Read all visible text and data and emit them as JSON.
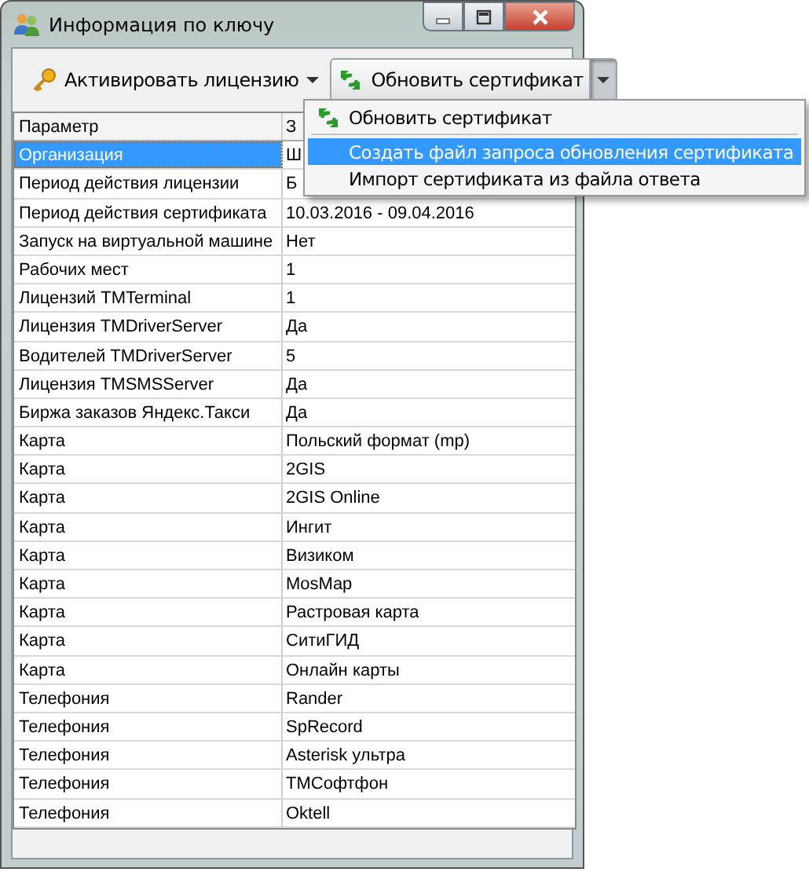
{
  "window": {
    "title": "Информация по ключу"
  },
  "toolbar": {
    "activate_button": {
      "label": "Активировать лицензию"
    },
    "update_button": {
      "label": "Обновить сертификат",
      "dropdown_open": true
    }
  },
  "menu": {
    "items": [
      {
        "label": "Обновить сертификат",
        "kind": "icon",
        "highlighted": false
      },
      {
        "kind": "separator"
      },
      {
        "label": "Создать файл запроса обновления сертификата",
        "kind": "plain",
        "highlighted": true
      },
      {
        "label": "Импорт сертификата из файла ответа",
        "kind": "plain",
        "highlighted": false
      }
    ]
  },
  "table": {
    "columns": [
      "Параметр",
      "З"
    ],
    "rows": [
      {
        "cells": [
          "Организация",
          "Ш"
        ],
        "selected": true
      },
      {
        "cells": [
          "Период действия лицензии",
          "Б"
        ],
        "selected": false
      },
      {
        "cells": [
          "Период действия сертификата",
          "10.03.2016 - 09.04.2016"
        ],
        "selected": false
      },
      {
        "cells": [
          "Запуск на виртуальной машине",
          "Нет"
        ],
        "selected": false
      },
      {
        "cells": [
          "Рабочих мест",
          "1"
        ],
        "selected": false
      },
      {
        "cells": [
          "Лицензий TMTerminal",
          "1"
        ],
        "selected": false
      },
      {
        "cells": [
          "Лицензия TMDriverServer",
          "Да"
        ],
        "selected": false
      },
      {
        "cells": [
          "Водителей TMDriverServer",
          "5"
        ],
        "selected": false
      },
      {
        "cells": [
          "Лицензия TMSMSServer",
          "Да"
        ],
        "selected": false
      },
      {
        "cells": [
          "Биржа заказов Яндекс.Такси",
          "Да"
        ],
        "selected": false
      },
      {
        "cells": [
          "Карта",
          "Польский формат (mp)"
        ],
        "selected": false
      },
      {
        "cells": [
          "Карта",
          "2GIS"
        ],
        "selected": false
      },
      {
        "cells": [
          "Карта",
          "2GIS Online"
        ],
        "selected": false
      },
      {
        "cells": [
          "Карта",
          "Ингит"
        ],
        "selected": false
      },
      {
        "cells": [
          "Карта",
          "Визиком"
        ],
        "selected": false
      },
      {
        "cells": [
          "Карта",
          "MosMap"
        ],
        "selected": false
      },
      {
        "cells": [
          "Карта",
          "Растровая карта"
        ],
        "selected": false
      },
      {
        "cells": [
          "Карта",
          "СитиГИД"
        ],
        "selected": false
      },
      {
        "cells": [
          "Карта",
          "Онлайн карты"
        ],
        "selected": false
      },
      {
        "cells": [
          "Телефония",
          "Rander"
        ],
        "selected": false
      },
      {
        "cells": [
          "Телефония",
          "SpRecord"
        ],
        "selected": false
      },
      {
        "cells": [
          "Телефония",
          "Asterisk ультра"
        ],
        "selected": false
      },
      {
        "cells": [
          "Телефония",
          "TMСофтфон"
        ],
        "selected": false
      },
      {
        "cells": [
          "Телефония",
          "Oktell"
        ],
        "selected": false
      }
    ]
  }
}
